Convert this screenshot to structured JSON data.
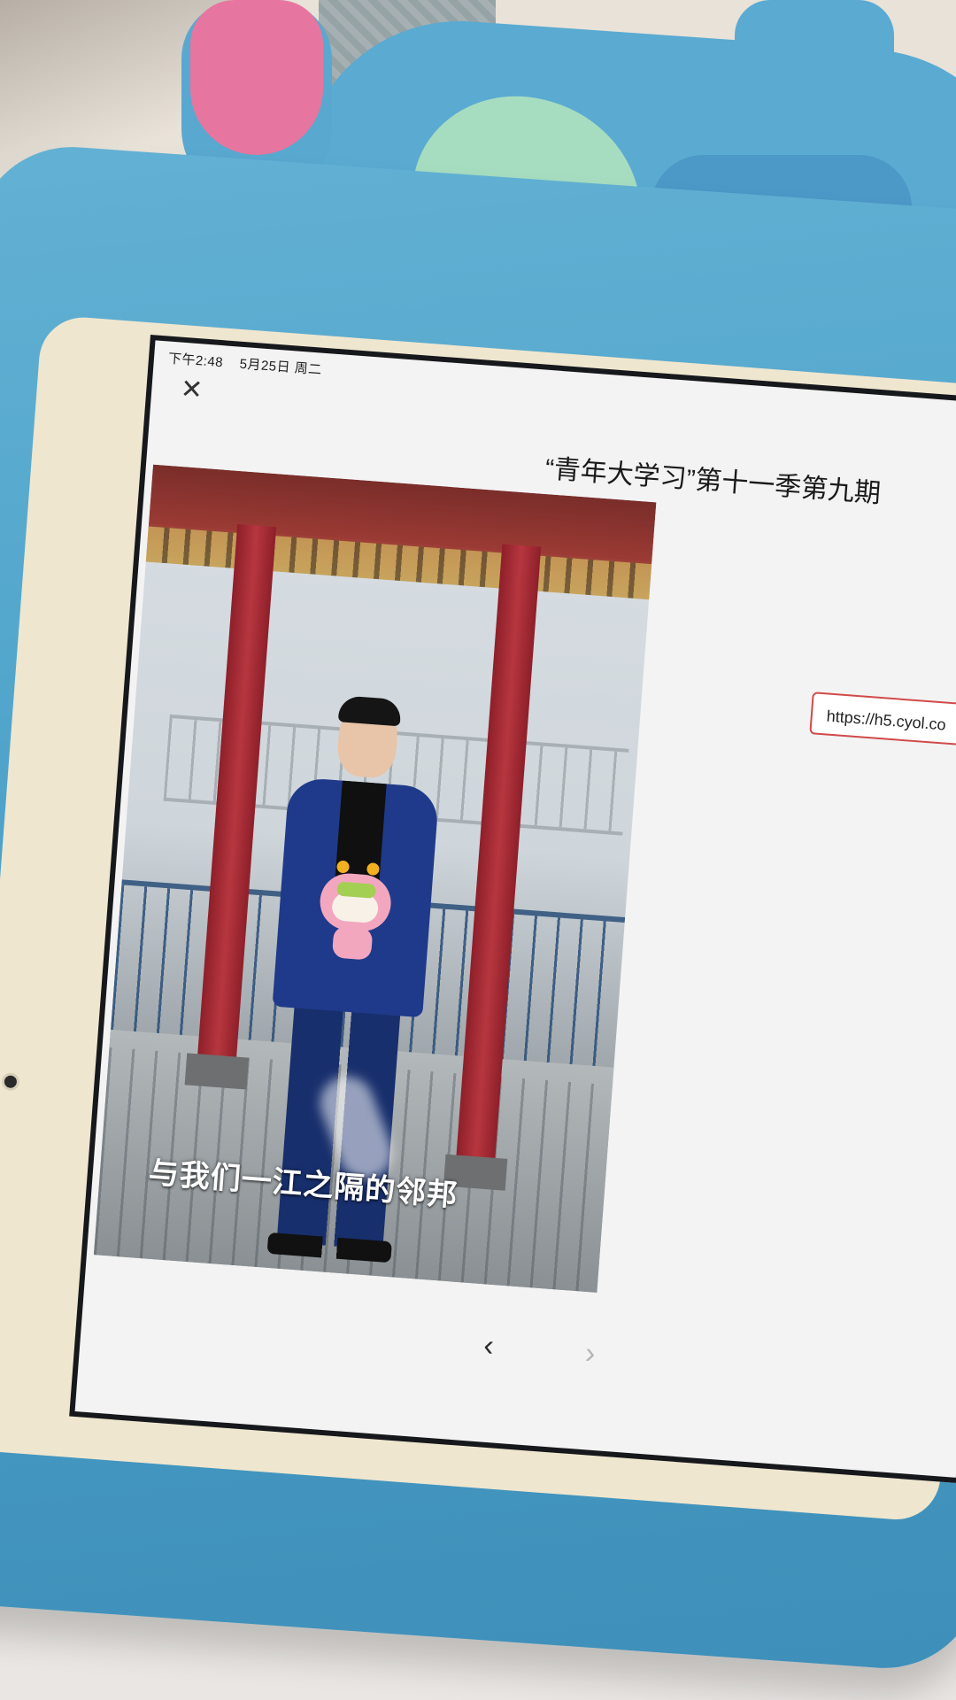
{
  "status_bar": {
    "time": "下午2:48",
    "date": "5月25日 周二"
  },
  "header": {
    "close_icon": "close-icon",
    "title": "“青年大学习”第十一季第九期"
  },
  "video": {
    "subtitle": "与我们一江之隔的邻邦"
  },
  "link": {
    "url_text": "https://h5.cyol.co"
  },
  "pager": {
    "prev_icon": "chevron-left-icon",
    "next_icon": "chevron-right-icon"
  },
  "colors": {
    "case_blue": "#4aa0c8",
    "link_border": "#d14a4a",
    "jacket": "#1f3a8a"
  }
}
